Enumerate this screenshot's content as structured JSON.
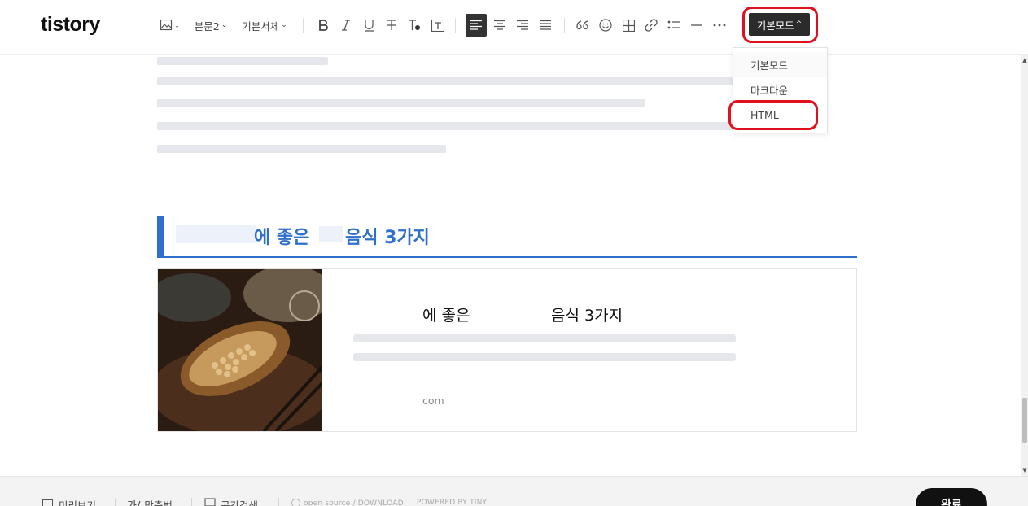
{
  "brand": {
    "logo": "tistory"
  },
  "toolbar": {
    "paragraph_style": "본문2",
    "font_family": "기본서체",
    "mode_label": "기본모드",
    "mode_caret": "^",
    "dropdown_caret": "⌄",
    "colors": {
      "accent_blue": "#2f6fcc",
      "highlight_red": "#e0101e",
      "mode_bg": "#2b2b2b"
    },
    "icons": [
      "image-icon",
      "bold-icon",
      "italic-icon",
      "underline-icon",
      "strikethrough-icon",
      "text-color-icon",
      "background-color-icon",
      "align-left-icon",
      "align-center-icon",
      "align-right-icon",
      "align-justify-icon",
      "quote-icon",
      "emoji-icon",
      "table-icon",
      "link-icon",
      "list-icon",
      "divider-icon",
      "more-icon"
    ]
  },
  "mode_dropdown": {
    "items": [
      {
        "label": "기본모드"
      },
      {
        "label": "마크다운"
      },
      {
        "label": "HTML"
      }
    ]
  },
  "content": {
    "heading": {
      "text_a": "에 좋은",
      "text_b": "음식 3가지"
    },
    "card": {
      "title_a": "에 좋은",
      "title_b": "음식 3가지",
      "link": "com"
    }
  },
  "bottombar": {
    "preview": "미리보기",
    "spellcheck": "맞춤법",
    "search": "공간검색",
    "opensource": "open source / DOWNLOAD",
    "powered": "POWERED BY TINY",
    "done": "완료"
  }
}
